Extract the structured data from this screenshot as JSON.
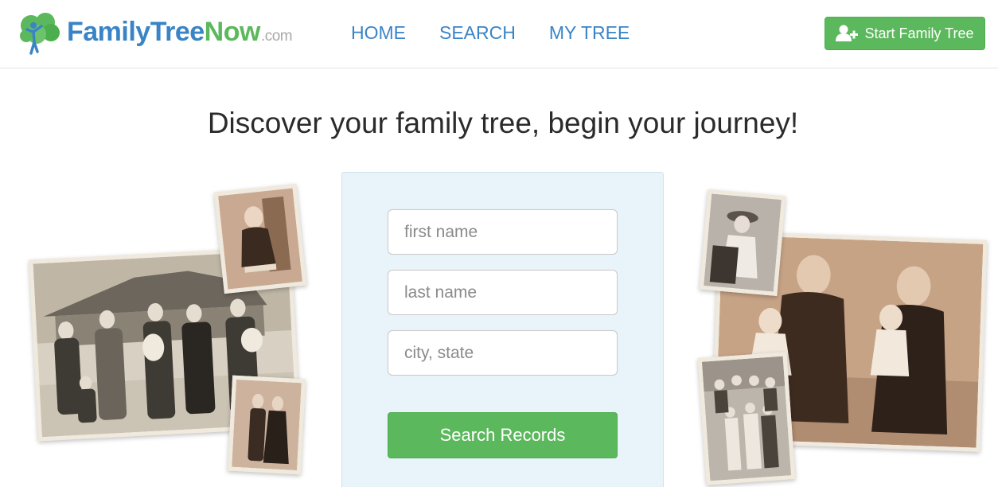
{
  "header": {
    "logo": {
      "family": "Family",
      "tree": "Tree",
      "now": "Now",
      "com": ".com"
    },
    "nav": [
      {
        "label": "HOME"
      },
      {
        "label": "SEARCH"
      },
      {
        "label": "MY TREE"
      }
    ],
    "start_button": {
      "label": "Start Family Tree",
      "icon": "add-user-icon"
    }
  },
  "hero": {
    "headline": "Discover your family tree, begin your journey!"
  },
  "search": {
    "first_name": {
      "placeholder": "first name",
      "value": ""
    },
    "last_name": {
      "placeholder": "last name",
      "value": ""
    },
    "city_state": {
      "placeholder": "city, state",
      "value": ""
    },
    "submit_label": "Search Records"
  },
  "photos": {
    "left": [
      "family-group-photo",
      "child-on-chair-photo",
      "wedding-couple-photo"
    ],
    "right": [
      "child-with-hat-photo",
      "family-portrait-photo",
      "group-portrait-photo"
    ]
  },
  "colors": {
    "brand_blue": "#3a84c6",
    "brand_green": "#5cb85c",
    "panel_bg": "#e8f3fa"
  }
}
